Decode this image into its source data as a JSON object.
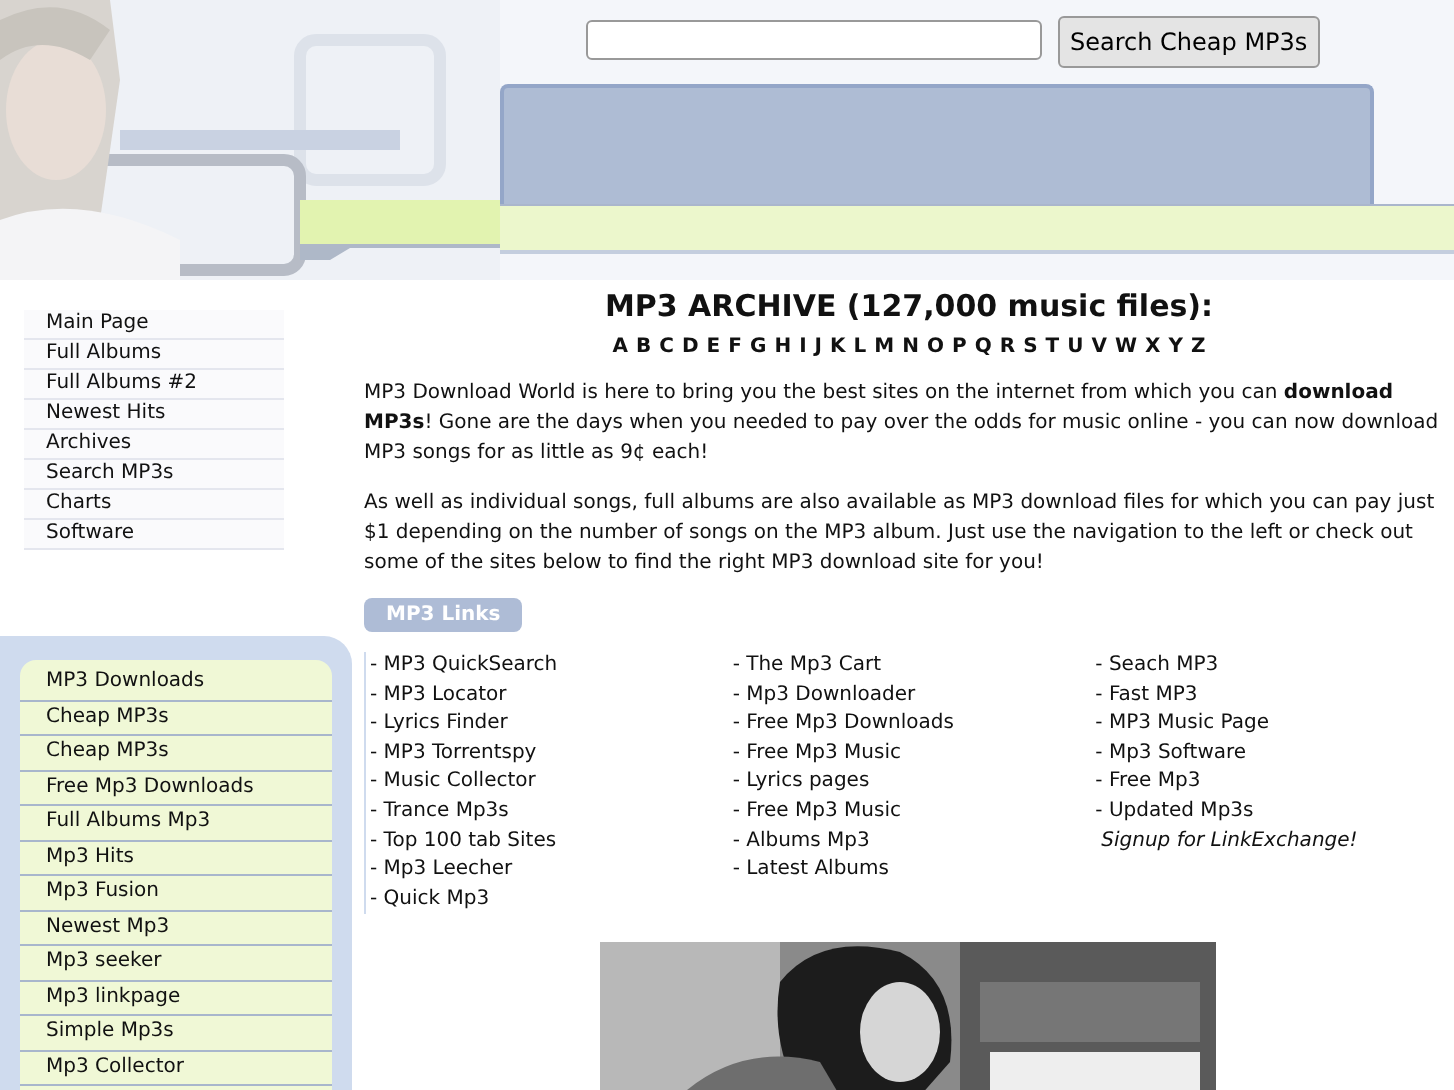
{
  "header": {
    "picture": {
      "kind": "picture"
    },
    "search": {
      "button": "Search Cheap MP3s"
    }
  },
  "nav": [
    "Main Page",
    "Full Albums",
    "Full Albums #2",
    "Newest Hits",
    "Archives",
    "Search MP3s",
    "Charts",
    "Software"
  ],
  "sidebar_links": [
    "MP3 Downloads",
    "Cheap MP3s",
    "Cheap MP3s",
    "Free Mp3 Downloads",
    "Full Albums Mp3",
    "Mp3 Hits",
    "Mp3 Fusion",
    "Newest Mp3",
    "Mp3 seeker",
    "Mp3 linkpage",
    "Simple Mp3s",
    "Mp3 Collector"
  ],
  "title": "MP3 ARCHIVE (127,000 music files):",
  "alphabet": [
    "A",
    "B",
    "C",
    "D",
    "E",
    "F",
    "G",
    "H",
    "I",
    "J",
    "K",
    "L",
    "M",
    "N",
    "O",
    "P",
    "Q",
    "R",
    "S",
    "T",
    "U",
    "V",
    "W",
    "X",
    "Y",
    "Z"
  ],
  "paragraphs": [
    "MP3 Download World is here to bring you the best sites on the internet from which you can **download MP3s**! Gone are the days when you needed to pay over the odds for music online - you can now download MP3 songs for as little as 9¢ each!",
    "As well as individual songs, full albums are also available as MP3 download files for which you can pay just $1 depending on the number of songs on the MP3 album. Just use the navigation to the left or check out some of the sites below to find the right MP3 download site for you!"
  ],
  "links_heading": "MP3 Links",
  "link_columns": [
    [
      {
        "kind": "link",
        "text": "- MP3 QuickSearch"
      },
      {
        "kind": "link",
        "text": "- MP3 Locator"
      },
      {
        "kind": "link",
        "text": "- Lyrics Finder"
      },
      {
        "kind": "link",
        "text": "- MP3 Torrentspy"
      },
      {
        "kind": "link",
        "text": "- Music Collector"
      },
      {
        "kind": "link",
        "text": "- Trance Mp3s"
      },
      {
        "kind": "link",
        "text": "- Top 100 tab Sites"
      },
      {
        "kind": "link",
        "text": "- Mp3 Leecher"
      },
      {
        "kind": "link",
        "text": "- Quick Mp3"
      }
    ],
    [
      {
        "kind": "link",
        "text": "- The Mp3 Cart"
      },
      {
        "kind": "link",
        "text": "- Mp3 Downloader"
      },
      {
        "kind": "link",
        "text": "- Free Mp3 Downloads"
      },
      {
        "kind": "link",
        "text": "- Free Mp3 Music"
      },
      {
        "kind": "link",
        "text": "- Lyrics pages"
      },
      {
        "kind": "link",
        "text": "- Free Mp3 Music"
      },
      {
        "kind": "link",
        "text": "- Albums Mp3"
      },
      {
        "kind": "link",
        "text": "- Latest Albums"
      }
    ],
    [
      {
        "kind": "link",
        "text": "- Seach MP3"
      },
      {
        "kind": "link",
        "text": "- Fast MP3"
      },
      {
        "kind": "link",
        "text": "- MP3 Music Page"
      },
      {
        "kind": "link",
        "text": "- Mp3 Software"
      },
      {
        "kind": "link",
        "text": "- Free Mp3"
      },
      {
        "kind": "link",
        "text": "- Updated Mp3s"
      },
      {
        "kind": "signup",
        "text": "Signup for LinkExchange!"
      }
    ]
  ],
  "banner": {
    "kind": "picture"
  }
}
